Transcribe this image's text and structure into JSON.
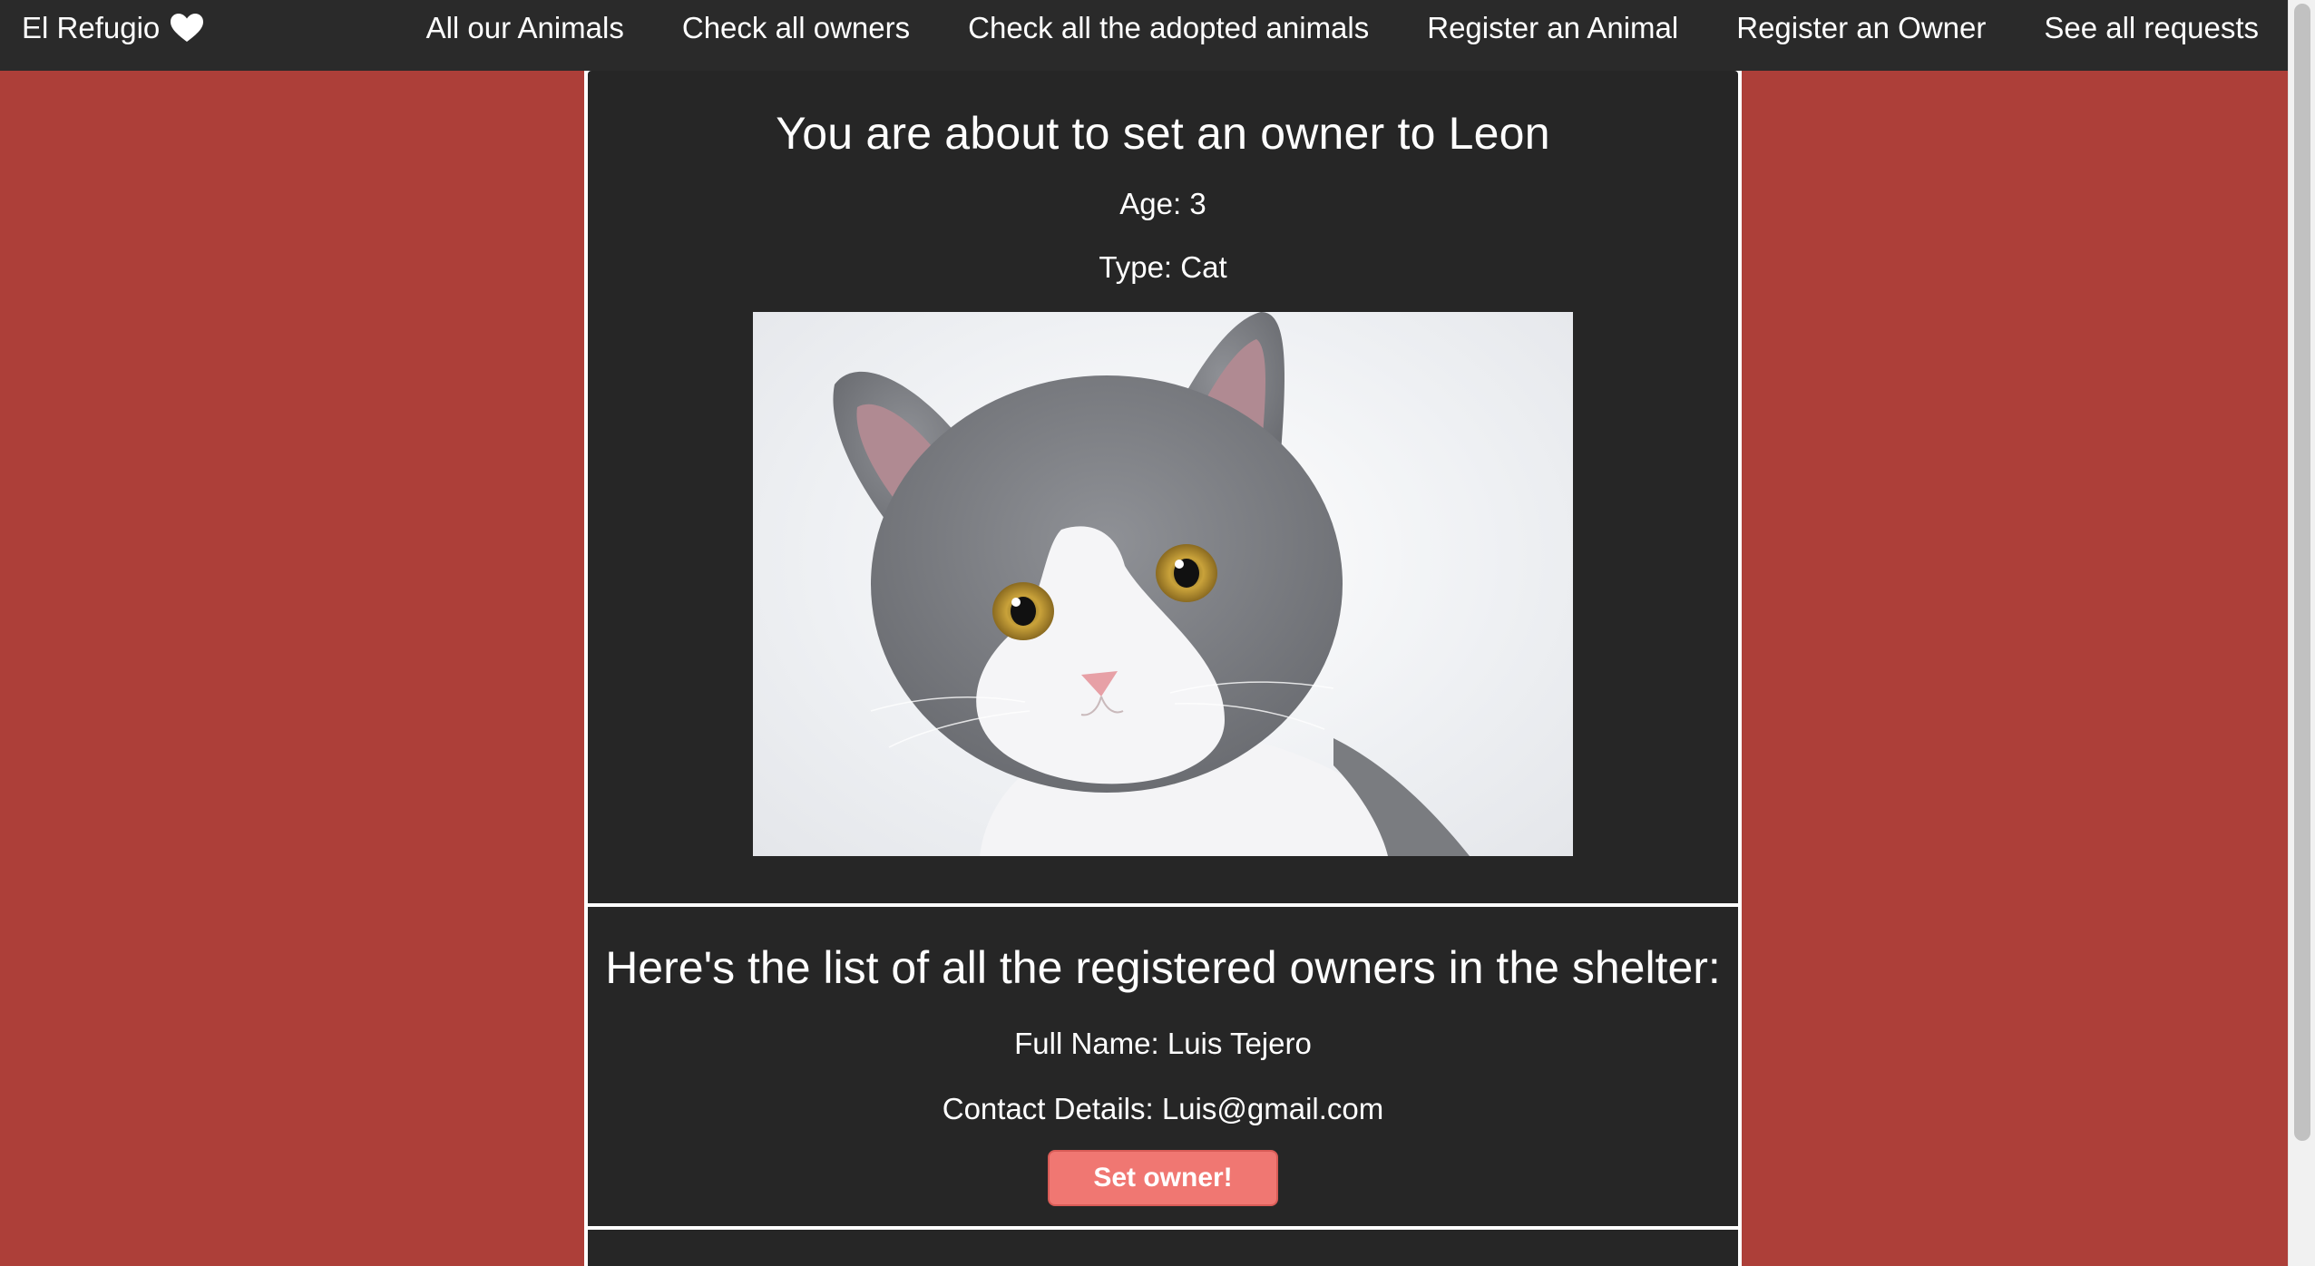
{
  "navbar": {
    "brand": "El Refugio",
    "brand_icon": "heart-icon",
    "links": [
      "All our Animals",
      "Check all owners",
      "Check all the adopted animals",
      "Register an Animal",
      "Register an Owner",
      "See all requests"
    ]
  },
  "animal": {
    "heading": "You are about to set an owner to Leon",
    "age": "Age: 3",
    "type": "Type: Cat",
    "photo_alt": "Cat"
  },
  "owners": {
    "heading": "Here's the list of all the registered owners in the shelter:",
    "items": [
      {
        "name": "Full Name: Luis Tejero",
        "contact": "Contact Details: Luis@gmail.com",
        "button": "Set owner!"
      }
    ]
  },
  "colors": {
    "background": "#ad3f39",
    "navbar": "#2a2a2a",
    "card": "#262626",
    "button": "#f07772"
  }
}
